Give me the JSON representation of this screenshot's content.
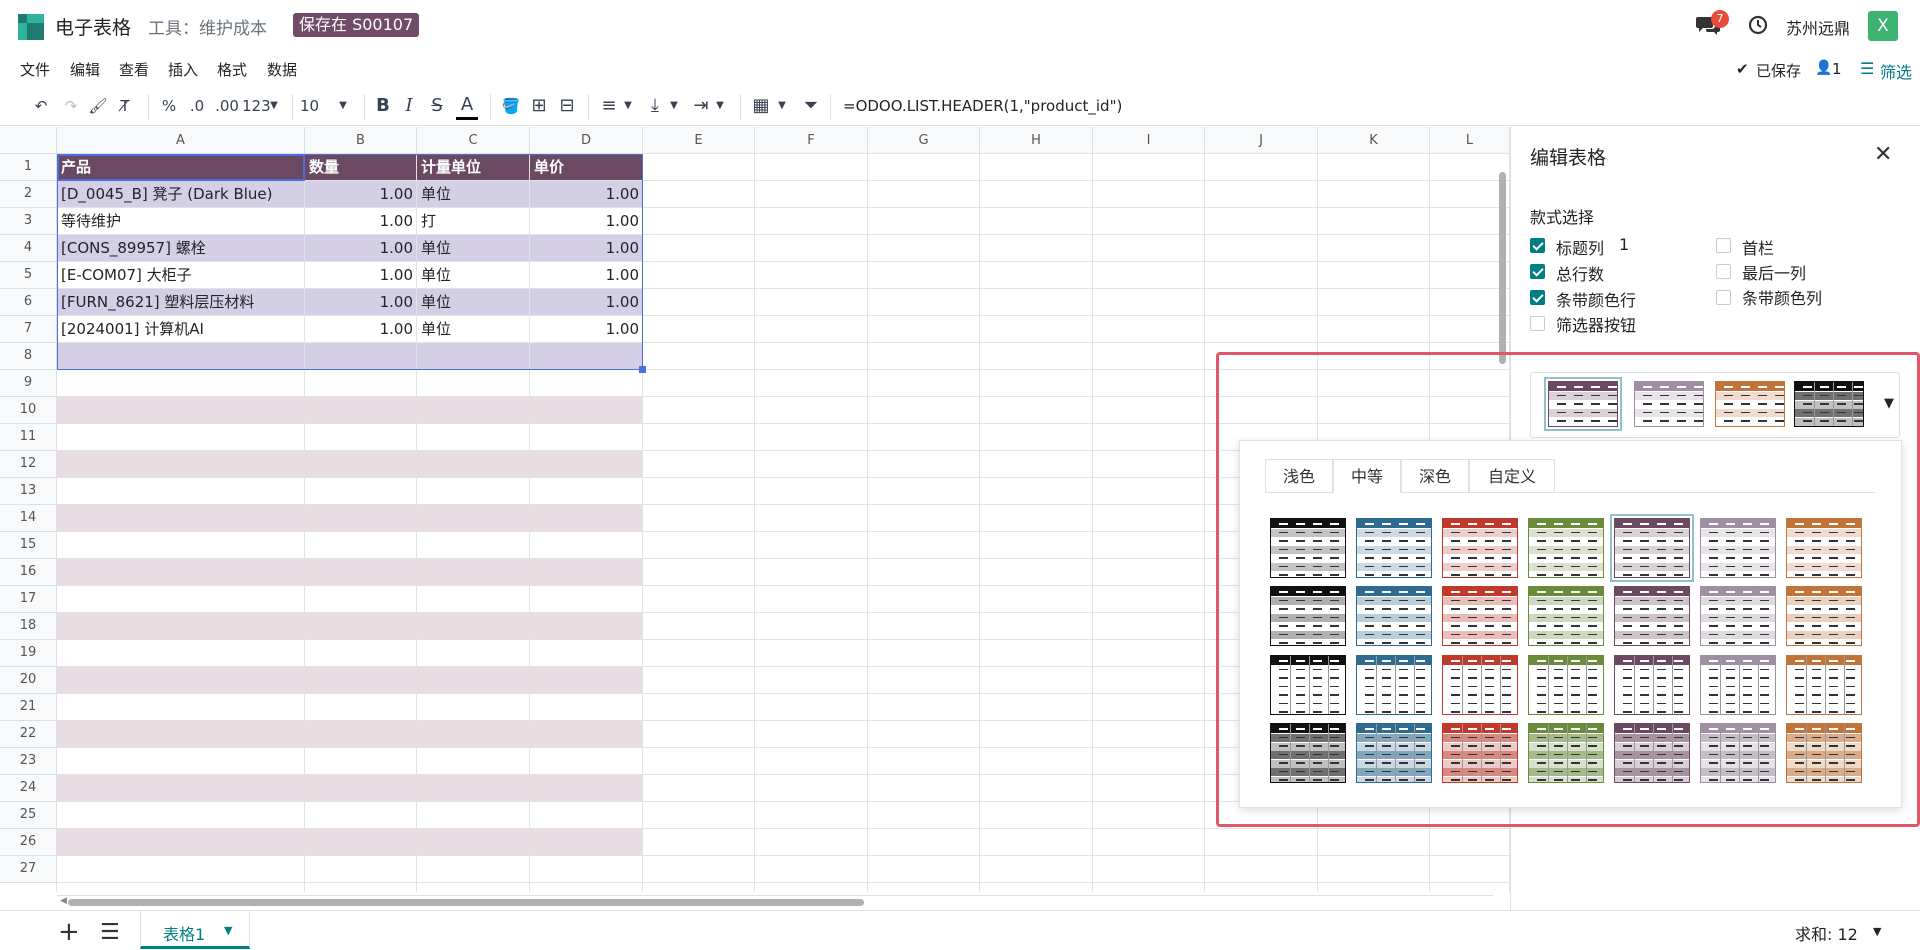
{
  "topbar": {
    "app_title": "电子表格",
    "tool_label": "工具：维护成本",
    "save_badge": "保存在 S00107",
    "chat_count": "7",
    "company": "苏州远鼎",
    "avatar_letter": "X"
  },
  "menu": [
    "文件",
    "编辑",
    "查看",
    "插入",
    "格式",
    "数据"
  ],
  "status": {
    "saved": "已保存",
    "users": "1",
    "filter": "筛选"
  },
  "toolbar": {
    "percent": "%",
    "dec_less": ".0",
    "dec_more": ".00",
    "num_format": "123",
    "font_size": "10",
    "bold": "B",
    "italic": "I",
    "strike": "S",
    "text_color": "A",
    "formula": "=ODOO.LIST.HEADER(1,\"product_id\")"
  },
  "grid": {
    "columns": [
      "A",
      "B",
      "C",
      "D",
      "E",
      "F",
      "G",
      "H",
      "I",
      "J",
      "K",
      "L"
    ],
    "rows": [
      "1",
      "2",
      "3",
      "4",
      "5",
      "6",
      "7",
      "8",
      "9",
      "10",
      "11",
      "12",
      "13",
      "14",
      "15",
      "16",
      "17",
      "18",
      "19",
      "20",
      "21",
      "22",
      "23",
      "24",
      "25",
      "26",
      "27"
    ],
    "header": [
      "产品",
      "数量",
      "计量单位",
      "单价"
    ],
    "data": [
      [
        "[D_0045_B] 凳子 (Dark Blue)",
        "1.00",
        "单位",
        "1.00"
      ],
      [
        "等待维护",
        "1.00",
        "打",
        "1.00"
      ],
      [
        "[CONS_89957] 螺栓",
        "1.00",
        "单位",
        "1.00"
      ],
      [
        "[E-COM07] 大柜子",
        "1.00",
        "单位",
        "1.00"
      ],
      [
        "[FURN_8621] 塑料层压材料",
        "1.00",
        "单位",
        "1.00"
      ],
      [
        "[2024001] 计算机AI",
        "1.00",
        "单位",
        "1.00"
      ]
    ]
  },
  "bottom": {
    "sheet_name": "表格1",
    "sum": "求和: 12"
  },
  "panel": {
    "title": "编辑表格",
    "section": "款式选择",
    "options_left": [
      {
        "label": "标题列",
        "checked": true,
        "value": "1"
      },
      {
        "label": "总行数",
        "checked": true
      },
      {
        "label": "条带颜色行",
        "checked": true
      },
      {
        "label": "筛选器按钮",
        "checked": false
      }
    ],
    "options_right": [
      {
        "label": "首栏",
        "checked": false
      },
      {
        "label": "最后一列",
        "checked": false
      },
      {
        "label": "条带颜色列",
        "checked": false
      }
    ],
    "tabs": [
      "浅色",
      "中等",
      "深色",
      "自定义"
    ],
    "active_tab": "中等"
  },
  "colors": {
    "accent": "#714b67",
    "teal": "#017e84",
    "table_header": "#6b4963",
    "table_band": "#d4cfe6",
    "table_band_light": "#e8dbe2",
    "highlight": "#e05868"
  },
  "style_palette": [
    "#111111",
    "#2f6a8f",
    "#c0392b",
    "#6b8a3c",
    "#6b4963",
    "#9e8fa3",
    "#c2733a"
  ]
}
